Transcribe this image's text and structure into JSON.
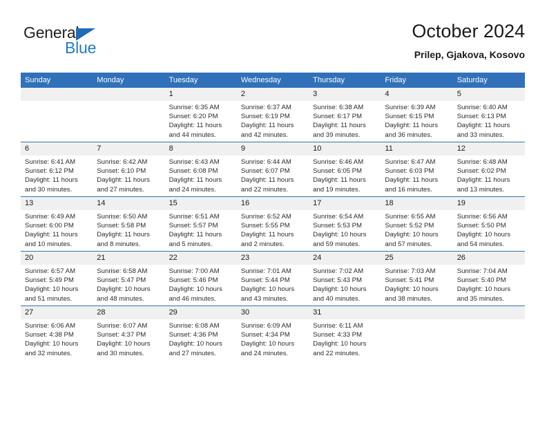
{
  "brand": {
    "name_top": "General",
    "name_bottom": "Blue",
    "icon": "triangle-flag-icon",
    "color_top": "#231f20",
    "color_bottom": "#1f7ac4",
    "flag_color": "#1e6bb8"
  },
  "header": {
    "month_title": "October 2024",
    "location": "Prilep, Gjakova, Kosovo"
  },
  "theme": {
    "header_bg": "#3071b9",
    "header_text": "#ffffff",
    "daynum_bg": "#f0f0f0",
    "separator": "#3071b9"
  },
  "weekday_headers": [
    "Sunday",
    "Monday",
    "Tuesday",
    "Wednesday",
    "Thursday",
    "Friday",
    "Saturday"
  ],
  "weeks": [
    [
      {
        "day": "",
        "sunrise": "",
        "sunset": "",
        "daylight_line1": "",
        "daylight_line2": ""
      },
      {
        "day": "",
        "sunrise": "",
        "sunset": "",
        "daylight_line1": "",
        "daylight_line2": ""
      },
      {
        "day": "1",
        "sunrise": "Sunrise: 6:35 AM",
        "sunset": "Sunset: 6:20 PM",
        "daylight_line1": "Daylight: 11 hours",
        "daylight_line2": "and 44 minutes."
      },
      {
        "day": "2",
        "sunrise": "Sunrise: 6:37 AM",
        "sunset": "Sunset: 6:19 PM",
        "daylight_line1": "Daylight: 11 hours",
        "daylight_line2": "and 42 minutes."
      },
      {
        "day": "3",
        "sunrise": "Sunrise: 6:38 AM",
        "sunset": "Sunset: 6:17 PM",
        "daylight_line1": "Daylight: 11 hours",
        "daylight_line2": "and 39 minutes."
      },
      {
        "day": "4",
        "sunrise": "Sunrise: 6:39 AM",
        "sunset": "Sunset: 6:15 PM",
        "daylight_line1": "Daylight: 11 hours",
        "daylight_line2": "and 36 minutes."
      },
      {
        "day": "5",
        "sunrise": "Sunrise: 6:40 AM",
        "sunset": "Sunset: 6:13 PM",
        "daylight_line1": "Daylight: 11 hours",
        "daylight_line2": "and 33 minutes."
      }
    ],
    [
      {
        "day": "6",
        "sunrise": "Sunrise: 6:41 AM",
        "sunset": "Sunset: 6:12 PM",
        "daylight_line1": "Daylight: 11 hours",
        "daylight_line2": "and 30 minutes."
      },
      {
        "day": "7",
        "sunrise": "Sunrise: 6:42 AM",
        "sunset": "Sunset: 6:10 PM",
        "daylight_line1": "Daylight: 11 hours",
        "daylight_line2": "and 27 minutes."
      },
      {
        "day": "8",
        "sunrise": "Sunrise: 6:43 AM",
        "sunset": "Sunset: 6:08 PM",
        "daylight_line1": "Daylight: 11 hours",
        "daylight_line2": "and 24 minutes."
      },
      {
        "day": "9",
        "sunrise": "Sunrise: 6:44 AM",
        "sunset": "Sunset: 6:07 PM",
        "daylight_line1": "Daylight: 11 hours",
        "daylight_line2": "and 22 minutes."
      },
      {
        "day": "10",
        "sunrise": "Sunrise: 6:46 AM",
        "sunset": "Sunset: 6:05 PM",
        "daylight_line1": "Daylight: 11 hours",
        "daylight_line2": "and 19 minutes."
      },
      {
        "day": "11",
        "sunrise": "Sunrise: 6:47 AM",
        "sunset": "Sunset: 6:03 PM",
        "daylight_line1": "Daylight: 11 hours",
        "daylight_line2": "and 16 minutes."
      },
      {
        "day": "12",
        "sunrise": "Sunrise: 6:48 AM",
        "sunset": "Sunset: 6:02 PM",
        "daylight_line1": "Daylight: 11 hours",
        "daylight_line2": "and 13 minutes."
      }
    ],
    [
      {
        "day": "13",
        "sunrise": "Sunrise: 6:49 AM",
        "sunset": "Sunset: 6:00 PM",
        "daylight_line1": "Daylight: 11 hours",
        "daylight_line2": "and 10 minutes."
      },
      {
        "day": "14",
        "sunrise": "Sunrise: 6:50 AM",
        "sunset": "Sunset: 5:58 PM",
        "daylight_line1": "Daylight: 11 hours",
        "daylight_line2": "and 8 minutes."
      },
      {
        "day": "15",
        "sunrise": "Sunrise: 6:51 AM",
        "sunset": "Sunset: 5:57 PM",
        "daylight_line1": "Daylight: 11 hours",
        "daylight_line2": "and 5 minutes."
      },
      {
        "day": "16",
        "sunrise": "Sunrise: 6:52 AM",
        "sunset": "Sunset: 5:55 PM",
        "daylight_line1": "Daylight: 11 hours",
        "daylight_line2": "and 2 minutes."
      },
      {
        "day": "17",
        "sunrise": "Sunrise: 6:54 AM",
        "sunset": "Sunset: 5:53 PM",
        "daylight_line1": "Daylight: 10 hours",
        "daylight_line2": "and 59 minutes."
      },
      {
        "day": "18",
        "sunrise": "Sunrise: 6:55 AM",
        "sunset": "Sunset: 5:52 PM",
        "daylight_line1": "Daylight: 10 hours",
        "daylight_line2": "and 57 minutes."
      },
      {
        "day": "19",
        "sunrise": "Sunrise: 6:56 AM",
        "sunset": "Sunset: 5:50 PM",
        "daylight_line1": "Daylight: 10 hours",
        "daylight_line2": "and 54 minutes."
      }
    ],
    [
      {
        "day": "20",
        "sunrise": "Sunrise: 6:57 AM",
        "sunset": "Sunset: 5:49 PM",
        "daylight_line1": "Daylight: 10 hours",
        "daylight_line2": "and 51 minutes."
      },
      {
        "day": "21",
        "sunrise": "Sunrise: 6:58 AM",
        "sunset": "Sunset: 5:47 PM",
        "daylight_line1": "Daylight: 10 hours",
        "daylight_line2": "and 48 minutes."
      },
      {
        "day": "22",
        "sunrise": "Sunrise: 7:00 AM",
        "sunset": "Sunset: 5:46 PM",
        "daylight_line1": "Daylight: 10 hours",
        "daylight_line2": "and 46 minutes."
      },
      {
        "day": "23",
        "sunrise": "Sunrise: 7:01 AM",
        "sunset": "Sunset: 5:44 PM",
        "daylight_line1": "Daylight: 10 hours",
        "daylight_line2": "and 43 minutes."
      },
      {
        "day": "24",
        "sunrise": "Sunrise: 7:02 AM",
        "sunset": "Sunset: 5:43 PM",
        "daylight_line1": "Daylight: 10 hours",
        "daylight_line2": "and 40 minutes."
      },
      {
        "day": "25",
        "sunrise": "Sunrise: 7:03 AM",
        "sunset": "Sunset: 5:41 PM",
        "daylight_line1": "Daylight: 10 hours",
        "daylight_line2": "and 38 minutes."
      },
      {
        "day": "26",
        "sunrise": "Sunrise: 7:04 AM",
        "sunset": "Sunset: 5:40 PM",
        "daylight_line1": "Daylight: 10 hours",
        "daylight_line2": "and 35 minutes."
      }
    ],
    [
      {
        "day": "27",
        "sunrise": "Sunrise: 6:06 AM",
        "sunset": "Sunset: 4:38 PM",
        "daylight_line1": "Daylight: 10 hours",
        "daylight_line2": "and 32 minutes."
      },
      {
        "day": "28",
        "sunrise": "Sunrise: 6:07 AM",
        "sunset": "Sunset: 4:37 PM",
        "daylight_line1": "Daylight: 10 hours",
        "daylight_line2": "and 30 minutes."
      },
      {
        "day": "29",
        "sunrise": "Sunrise: 6:08 AM",
        "sunset": "Sunset: 4:36 PM",
        "daylight_line1": "Daylight: 10 hours",
        "daylight_line2": "and 27 minutes."
      },
      {
        "day": "30",
        "sunrise": "Sunrise: 6:09 AM",
        "sunset": "Sunset: 4:34 PM",
        "daylight_line1": "Daylight: 10 hours",
        "daylight_line2": "and 24 minutes."
      },
      {
        "day": "31",
        "sunrise": "Sunrise: 6:11 AM",
        "sunset": "Sunset: 4:33 PM",
        "daylight_line1": "Daylight: 10 hours",
        "daylight_line2": "and 22 minutes."
      },
      {
        "day": "",
        "sunrise": "",
        "sunset": "",
        "daylight_line1": "",
        "daylight_line2": ""
      },
      {
        "day": "",
        "sunrise": "",
        "sunset": "",
        "daylight_line1": "",
        "daylight_line2": ""
      }
    ]
  ]
}
